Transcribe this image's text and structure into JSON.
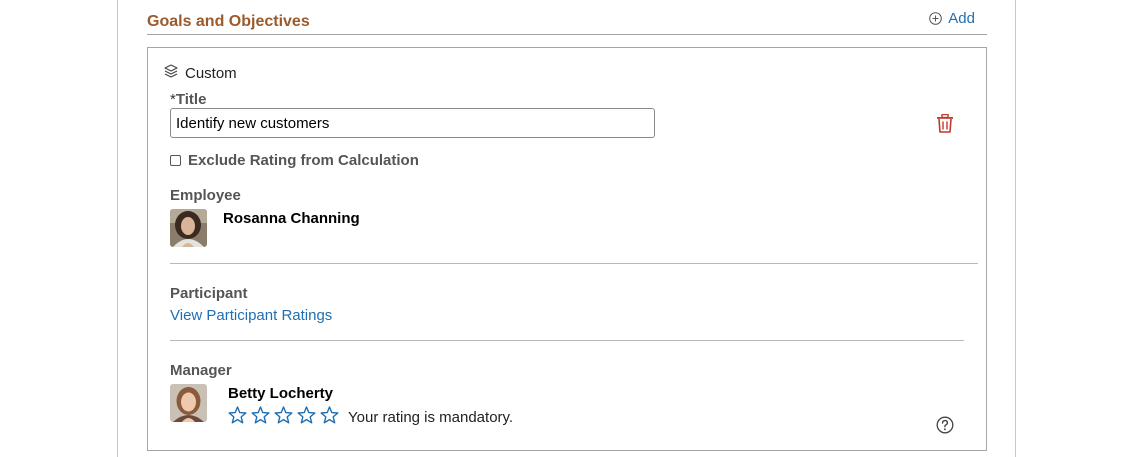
{
  "section": {
    "title": "Goals and Objectives",
    "add_label": "Add"
  },
  "goal": {
    "type_label": "Custom",
    "title_label_star": "*",
    "title_label": "Title",
    "title_value": "Identify new customers",
    "exclude_rating_label": "Exclude Rating from Calculation",
    "exclude_rating_checked": false
  },
  "employee": {
    "heading": "Employee",
    "name": "Rosanna Channing"
  },
  "participant": {
    "heading": "Participant",
    "link_label": "View Participant Ratings"
  },
  "manager": {
    "heading": "Manager",
    "name": "Betty Locherty",
    "rating": 0,
    "rating_max": 5,
    "rating_note": "Your rating is mandatory."
  },
  "colors": {
    "section_title": "#9b5a2b",
    "link": "#1f6fb2",
    "delete_icon": "#c0392b",
    "label": "#555555"
  },
  "icons": {
    "add": "plus-circle-icon",
    "type": "layers-icon",
    "delete": "trash-icon",
    "rating": "star-outline-icon",
    "help": "question-circle-icon"
  }
}
